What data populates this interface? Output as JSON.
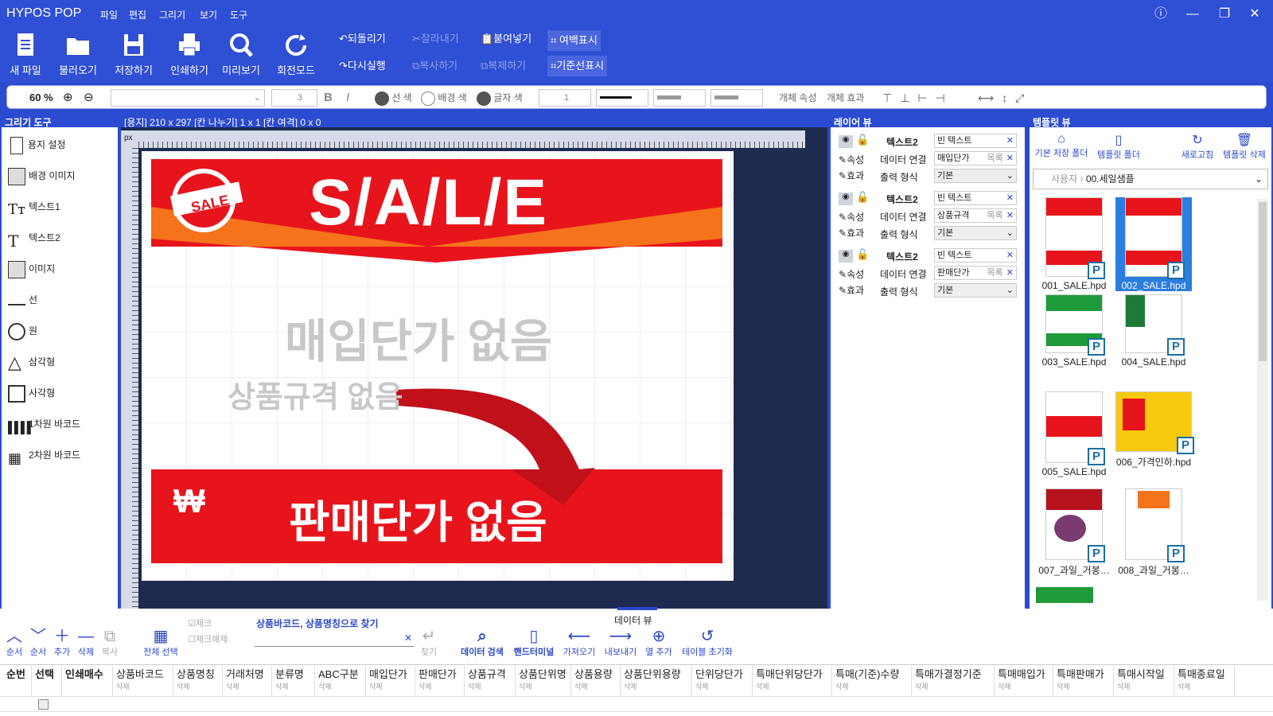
{
  "app": {
    "title": "HYPOS POP"
  },
  "menu": [
    "파일",
    "편집",
    "그리기",
    "보기",
    "도구"
  ],
  "ribbon": {
    "big": [
      {
        "label": "새 파일",
        "icon": "new-file-icon"
      },
      {
        "label": "불러오기",
        "icon": "folder-icon"
      },
      {
        "label": "저장하기",
        "icon": "save-icon"
      },
      {
        "label": "인쇄하기",
        "icon": "print-icon"
      },
      {
        "label": "미리보기",
        "icon": "preview-icon"
      },
      {
        "label": "회전모드",
        "icon": "rotate-icon"
      }
    ],
    "small": [
      {
        "label": "되돌리기",
        "enabled": true
      },
      {
        "label": "다시실행",
        "enabled": true
      },
      {
        "label": "잘라내기",
        "enabled": false
      },
      {
        "label": "복사하기",
        "enabled": false
      },
      {
        "label": "붙여넣기",
        "enabled": true
      },
      {
        "label": "복제하기",
        "enabled": false
      },
      {
        "label": "여백표시",
        "enabled": true
      },
      {
        "label": "기준선표시",
        "enabled": true
      }
    ]
  },
  "toolbar": {
    "zoom": "60 %",
    "font_size": "3",
    "line_color": "선 색",
    "bg_color": "배경 색",
    "text_color": "글자 색",
    "line_width": "1",
    "obj_props": "개체 속성",
    "obj_effect": "개체 효과"
  },
  "left": {
    "title": "그리기 도구",
    "tools": [
      "용지 설정",
      "배경 이미지",
      "텍스트1",
      "텍스트2",
      "이미지",
      "선",
      "원",
      "삼각형",
      "사각형",
      "1차원 바코드",
      "2차원 바코드"
    ]
  },
  "canvas": {
    "header": "[용지] 210 x 297  [칸 나누기] 1 x 1  [칸 여격] 0 x 0",
    "ruler_unit": "px",
    "sale_title": "S/A/L/E",
    "badge": "SALE",
    "purchase_price": "매입단가 없음",
    "spec": "상품규격 없음",
    "currency": "₩",
    "sale_price": "판매단가 없음"
  },
  "layers": {
    "title": "레이어 뷰",
    "items": [
      {
        "name": "텍스트2",
        "text": "빈 텍스트",
        "link_label": "데이터 연결",
        "link": "매입단가",
        "list": "목록",
        "format_label": "출력 형식",
        "format": "기본",
        "prop": "속성",
        "effect": "효과"
      },
      {
        "name": "텍스트2",
        "text": "빈 텍스트",
        "link_label": "데이터 연결",
        "link": "상품규격",
        "list": "목록",
        "format_label": "출력 형식",
        "format": "기본",
        "prop": "속성",
        "effect": "효과"
      },
      {
        "name": "텍스트2",
        "text": "빈 텍스트",
        "link_label": "데이터 연결",
        "link": "판매단가",
        "list": "목록",
        "format_label": "출력 형식",
        "format": "기본",
        "prop": "속성",
        "effect": "효과"
      }
    ]
  },
  "templates": {
    "title": "템플릿 뷰",
    "actions": [
      "기본 저장 폴더",
      "템플릿 폴더",
      "새로고침",
      "템플릿 삭제"
    ],
    "path_root": "사용자",
    "path_leaf": "00.세일샘플",
    "items": [
      {
        "name": "001_SALE.hpd",
        "selected": false
      },
      {
        "name": "002_SALE.hpd",
        "selected": true
      },
      {
        "name": "003_SALE.hpd",
        "selected": false
      },
      {
        "name": "004_SALE.hpd",
        "selected": false
      },
      {
        "name": "005_SALE.hpd",
        "selected": false
      },
      {
        "name": "006_가격인하.hpd",
        "selected": false
      },
      {
        "name": "007_과일_거봉…",
        "selected": false
      },
      {
        "name": "008_과일_거봉…",
        "selected": false
      }
    ],
    "badge": "P"
  },
  "data": {
    "title": "데이터 뷰",
    "buttons": [
      "순서",
      "순서",
      "추가",
      "삭제",
      "복사",
      "전체 선택",
      "체크",
      "체크해제"
    ],
    "search_label": "상품바코드, 상품명칭으로 찾기",
    "find": "찾기",
    "actions": [
      "데이터 검색",
      "핸드터미널",
      "가져오기",
      "내보내기",
      "열 추가",
      "테이블 초기화"
    ],
    "columns": [
      "순번",
      "선택",
      "인쇄매수",
      "상품바코드",
      "상품명칭",
      "거래처명",
      "분류명",
      "ABC구분",
      "매입단가",
      "판매단가",
      "상품규격",
      "상품단위명",
      "상품용량",
      "상품단위용량",
      "단위당단가",
      "특매단위당단가",
      "특매(기준)수량",
      "특매가결정기준",
      "특매매입가",
      "특매판매가",
      "특매시작일",
      "특매종료일"
    ],
    "col_sub": "삭제"
  }
}
